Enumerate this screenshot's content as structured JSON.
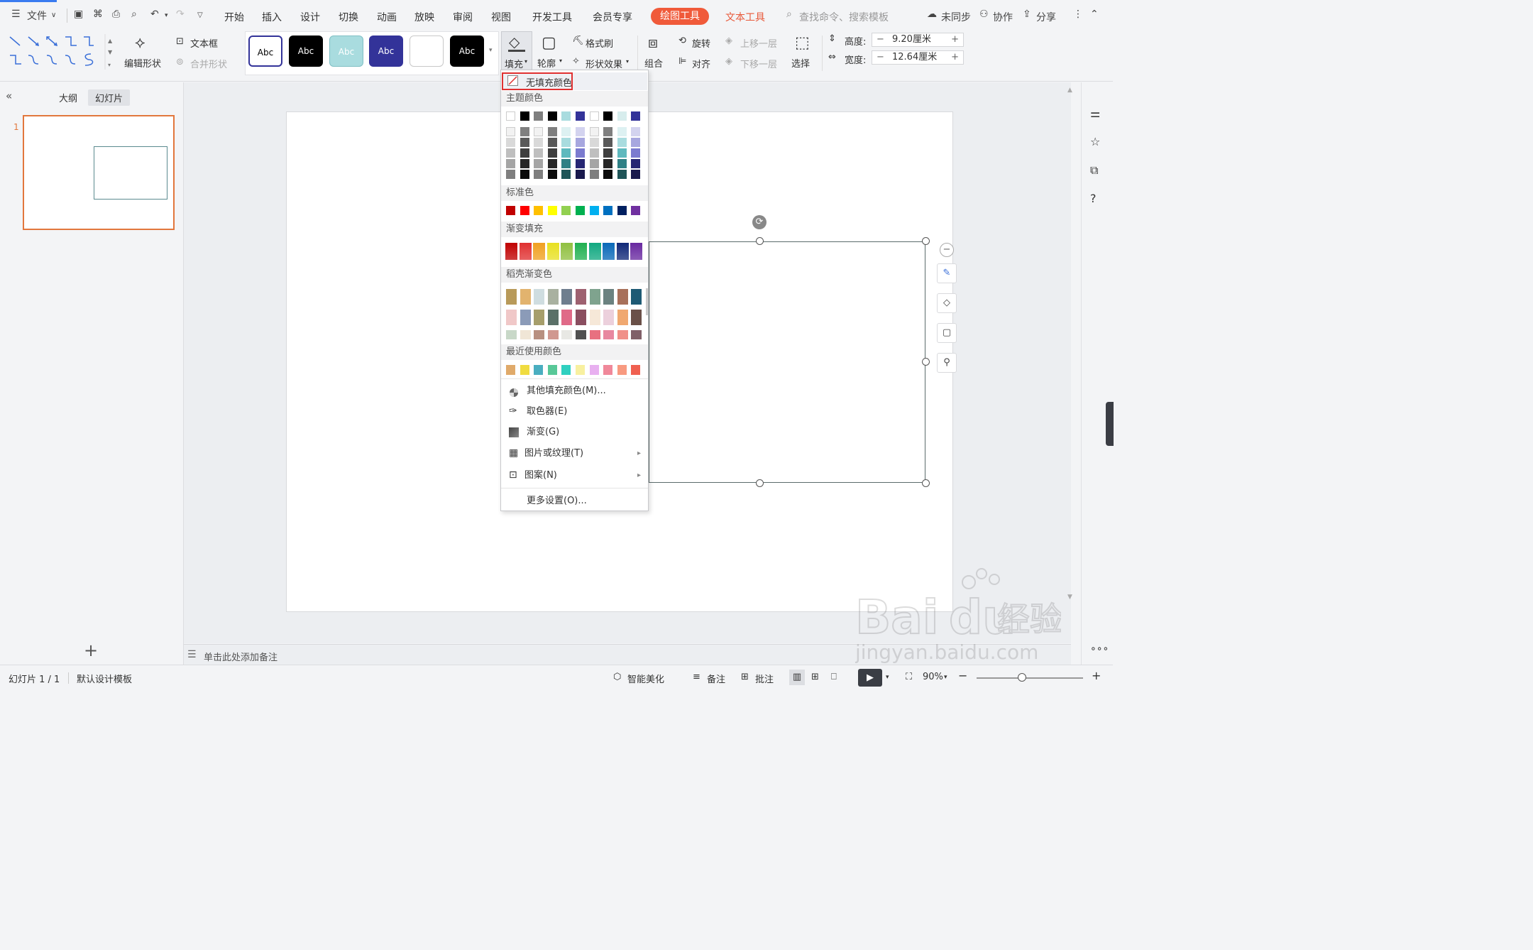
{
  "topbar": {
    "file_menu": "文件",
    "tabs": [
      "开始",
      "插入",
      "设计",
      "切换",
      "动画",
      "放映",
      "审阅",
      "视图",
      "开发工具",
      "会员专享"
    ],
    "active_tab": "绘图工具",
    "text_tool_tab": "文本工具",
    "search_placeholder": "查找命令、搜索模板",
    "sync": "未同步",
    "collaborate": "协作",
    "share": "分享"
  },
  "ribbon": {
    "edit_shape": "编辑形状",
    "textbox": "文本框",
    "merge_shape": "合并形状",
    "style_label": "Abc",
    "fill": "填充",
    "outline": "轮廓",
    "format_painter": "格式刷",
    "shape_effect": "形状效果",
    "group": "组合",
    "rotate": "旋转",
    "align": "对齐",
    "bring_forward": "上移一层",
    "send_backward": "下移一层",
    "select": "选择",
    "height_label": "高度:",
    "height_value": "9.20厘米",
    "width_label": "宽度:",
    "width_value": "12.64厘米"
  },
  "left_panel": {
    "tab_outline": "大纲",
    "tab_slides": "幻灯片",
    "slide_number": "1"
  },
  "notes": {
    "placeholder": "单击此处添加备注"
  },
  "status": {
    "slide_info": "幻灯片 1 / 1",
    "template": "默认设计模板",
    "beautify": "智能美化",
    "notes": "备注",
    "comment": "批注",
    "zoom": "90%"
  },
  "dropdown": {
    "no_fill": "无填充颜色",
    "theme_colors_title": "主题颜色",
    "standard_colors_title": "标准色",
    "gradient_fill_title": "渐变填充",
    "docer_gradient_title": "稻壳渐变色",
    "recent_colors_title": "最近使用颜色",
    "more_fill_colors": "其他填充颜色(M)...",
    "eyedropper": "取色器(E)",
    "gradient": "渐变(G)",
    "picture_texture": "图片或纹理(T)",
    "pattern": "图案(N)",
    "more_settings": "更多设置(O)...",
    "theme_top_row": [
      "#ffffff",
      "#000000",
      "#7f7f7f",
      "#000000",
      "#a9dcdf",
      "#333399",
      "#ffffff",
      "#000000",
      "#d7eded",
      "#333399"
    ],
    "theme_shades": [
      [
        "#f2f2f2",
        "#7f7f7f",
        "#f2f2f2",
        "#7f7f7f",
        "#ddf1f2",
        "#d3d3ef",
        "#f2f2f2",
        "#7f7f7f",
        "#ddf1f2",
        "#d3d3ef"
      ],
      [
        "#d9d9d9",
        "#595959",
        "#d9d9d9",
        "#595959",
        "#a9dcdf",
        "#a7a7df",
        "#d9d9d9",
        "#595959",
        "#a9dcdf",
        "#a7a7df"
      ],
      [
        "#bfbfbf",
        "#3f3f3f",
        "#bfbfbf",
        "#3f3f3f",
        "#5fb9be",
        "#7b7bcf",
        "#bfbfbf",
        "#3f3f3f",
        "#5fb9be",
        "#7b7bcf"
      ],
      [
        "#a5a5a5",
        "#262626",
        "#a5a5a5",
        "#262626",
        "#2f8085",
        "#262673",
        "#a5a5a5",
        "#262626",
        "#2f8085",
        "#262673"
      ],
      [
        "#7f7f7f",
        "#0c0c0c",
        "#7f7f7f",
        "#0c0c0c",
        "#1f5558",
        "#1a1a4d",
        "#7f7f7f",
        "#0c0c0c",
        "#1f5558",
        "#1a1a4d"
      ]
    ],
    "standard": [
      "#c00000",
      "#ff0000",
      "#ffc000",
      "#ffff00",
      "#92d050",
      "#00b050",
      "#00b0f0",
      "#0070c0",
      "#002060",
      "#7030a0"
    ],
    "gradients": [
      "#c00000",
      "#e03030",
      "#f0a020",
      "#e8e020",
      "#90c040",
      "#20b050",
      "#10a880",
      "#0868b8",
      "#102878",
      "#6828a0"
    ],
    "docer": [
      [
        "#b89a5a",
        "#e2b36e",
        "#cfdde0",
        "#a9b1a0",
        "#6f7e8e",
        "#9e6170",
        "#7fa38e",
        "#6b8280",
        "#a8705a",
        "#1e5a74"
      ],
      [
        "#f0c8c8",
        "#8b9bb8",
        "#a69e6b",
        "#5a7068",
        "#e06a88",
        "#8a4e60",
        "#f6e8d8",
        "#ecd0dc",
        "#f0a870",
        "#6a5048"
      ],
      [
        "#c8d8c8",
        "#f0e6d6",
        "#b89080",
        "#d09890",
        "#e8e8e4",
        "#505050",
        "#e87080",
        "#e888a0",
        "#f09088",
        "#806068"
      ]
    ],
    "recent": [
      "#e0aa6a",
      "#f0dc40",
      "#4aaec0",
      "#58c898",
      "#30d0c0",
      "#f8f0a0",
      "#e8b0f0",
      "#f0889a",
      "#f89a80",
      "#f06050"
    ]
  }
}
